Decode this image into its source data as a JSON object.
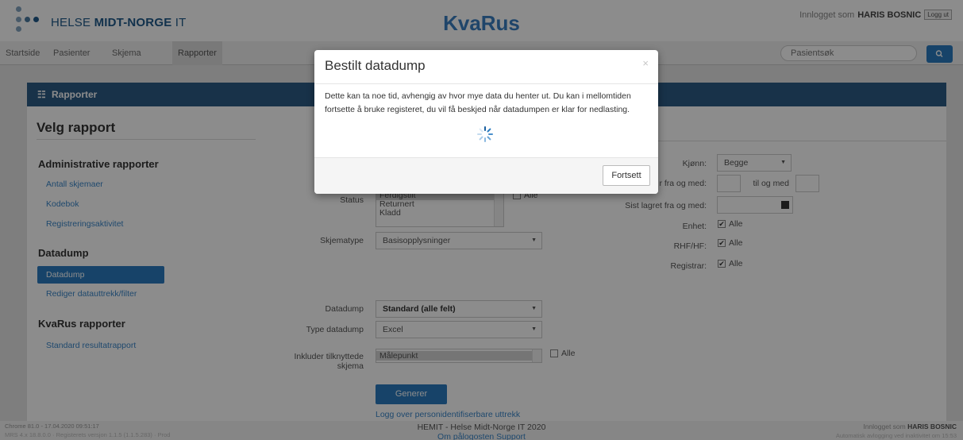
{
  "header": {
    "logo_prefix": "HELSE ",
    "logo_bold": "MIDT-NORGE",
    "logo_suffix": " IT",
    "app_title": "KvaRus",
    "login_prefix": "Innlogget som",
    "login_user": "HARIS BOSNIC",
    "logout_label": "Logg ut"
  },
  "nav": {
    "items": [
      "Startside",
      "Pasienter",
      "Skjema",
      "Rapporter"
    ],
    "active": "Rapporter",
    "search_placeholder": "Pasientsøk"
  },
  "panel": {
    "title": "Rapporter",
    "velg": "Velg rapport",
    "sections": [
      {
        "title": "Administrative rapporter",
        "links": [
          "Antall skjemaer",
          "Kodebok",
          "Registreringsaktivitet"
        ]
      },
      {
        "title": "Datadump",
        "links": [
          "Datadump",
          "Rediger datauttrekk/filter"
        ]
      },
      {
        "title": "KvaRus rapporter",
        "links": [
          "Standard resultatrapport"
        ]
      }
    ],
    "active_link": "Datadump"
  },
  "form": {
    "status_label": "Status",
    "status_options": [
      "Ferdigstilt",
      "Returnert",
      "Kladd"
    ],
    "status_alle": "Alle",
    "skjematype_label": "Skjematype",
    "skjematype_value": "Basisopplysninger",
    "datadump_label": "Datadump",
    "datadump_value": "Standard (alle felt)",
    "type_label": "Type datadump",
    "type_value": "Excel",
    "inkluder_label_1": "Inkluder tilknyttede",
    "inkluder_label_2": "skjema",
    "inkluder_value": "Målepunkt",
    "inkluder_alle": "Alle",
    "generer": "Generer",
    "logg_link": "Logg over personidentifiserbare uttrekk",
    "kjonn_label": "Kjønn:",
    "kjonn_value": "Begge",
    "fra_label": "r fra og med:",
    "til_label": "til og med",
    "sist_label": "Sist lagret fra og med:",
    "enhet_label": "Enhet:",
    "rhf_label": "RHF/HF:",
    "registrar_label": "Registrar:",
    "alle": "Alle"
  },
  "footer": {
    "left1": "Chrome 81.0 - 17.04.2020 09:51:17",
    "left2": "MRS 4.x 18.8.0.0 · Registerets versjon 1.1.5 (1.1.5.283) · Prod",
    "center": "HEMIT - Helse Midt-Norge IT 2020",
    "links": "Om pålogosten   Support",
    "right1_prefix": "Innlogget som",
    "right1_user": "HARIS BOSNIC",
    "right2": "Automatisk avlogging ved inaktivitet om 15:53"
  },
  "modal": {
    "title": "Bestilt datadump",
    "close": "×",
    "text": "Dette kan ta noe tid, avhengig av hvor mye data du henter ut. Du kan i mellomtiden fortsette å bruke registeret, du vil få beskjed når datadumpen er klar for nedlasting.",
    "button": "Fortsett"
  },
  "colors": {
    "brand": "#1f5a8a",
    "panel_header": "#2d5b85",
    "primary": "#2a7bbf",
    "link": "#3a86c8"
  }
}
